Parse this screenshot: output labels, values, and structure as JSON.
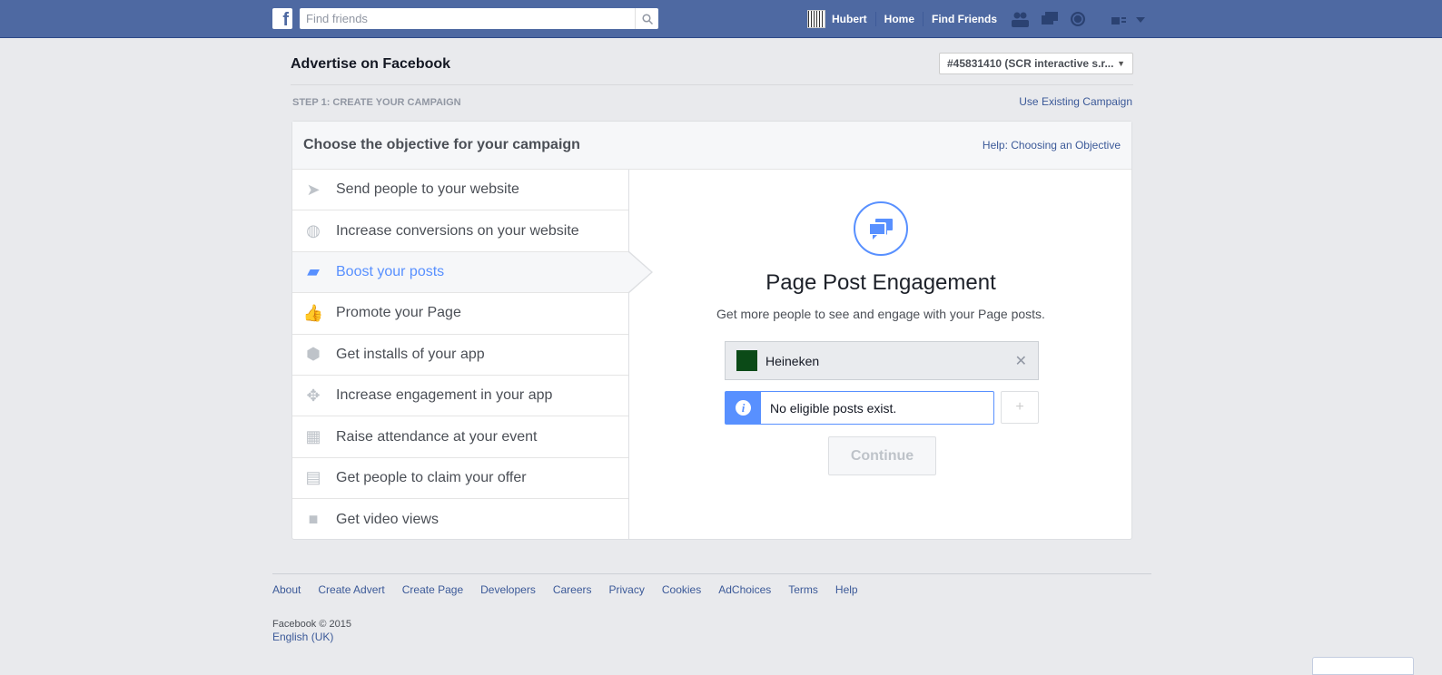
{
  "topbar": {
    "search_placeholder": "Find friends",
    "user": "Hubert",
    "home": "Home",
    "find_friends": "Find Friends"
  },
  "header": {
    "title": "Advertise on Facebook",
    "account": "#45831410 (SCR interactive s.r...",
    "step": "STEP 1: CREATE YOUR CAMPAIGN",
    "use_existing": "Use Existing Campaign"
  },
  "card": {
    "title": "Choose the objective for your campaign",
    "help": "Help: Choosing an Objective",
    "objectives": [
      {
        "label": "Send people to your website",
        "icon": "cursor-icon"
      },
      {
        "label": "Increase conversions on your website",
        "icon": "globe-icon"
      },
      {
        "label": "Boost your posts",
        "icon": "speech-bubbles-icon",
        "active": true
      },
      {
        "label": "Promote your Page",
        "icon": "thumbs-up-icon"
      },
      {
        "label": "Get installs of your app",
        "icon": "box-icon"
      },
      {
        "label": "Increase engagement in your app",
        "icon": "gamepad-icon"
      },
      {
        "label": "Raise attendance at your event",
        "icon": "calendar-icon"
      },
      {
        "label": "Get people to claim your offer",
        "icon": "store-icon"
      },
      {
        "label": "Get video views",
        "icon": "video-camera-icon"
      }
    ],
    "detail": {
      "title": "Page Post Engagement",
      "description": "Get more people to see and engage with your Page posts.",
      "page": "Heineken",
      "info": "No eligible posts exist.",
      "plus": "+",
      "continue": "Continue"
    }
  },
  "footer": {
    "links": [
      "About",
      "Create Advert",
      "Create Page",
      "Developers",
      "Careers",
      "Privacy",
      "Cookies",
      "AdChoices",
      "Terms",
      "Help"
    ],
    "copyright": "Facebook © 2015",
    "language": "English (UK)"
  },
  "colors": {
    "brand": "#4e69a2",
    "accent": "#5890ff"
  }
}
